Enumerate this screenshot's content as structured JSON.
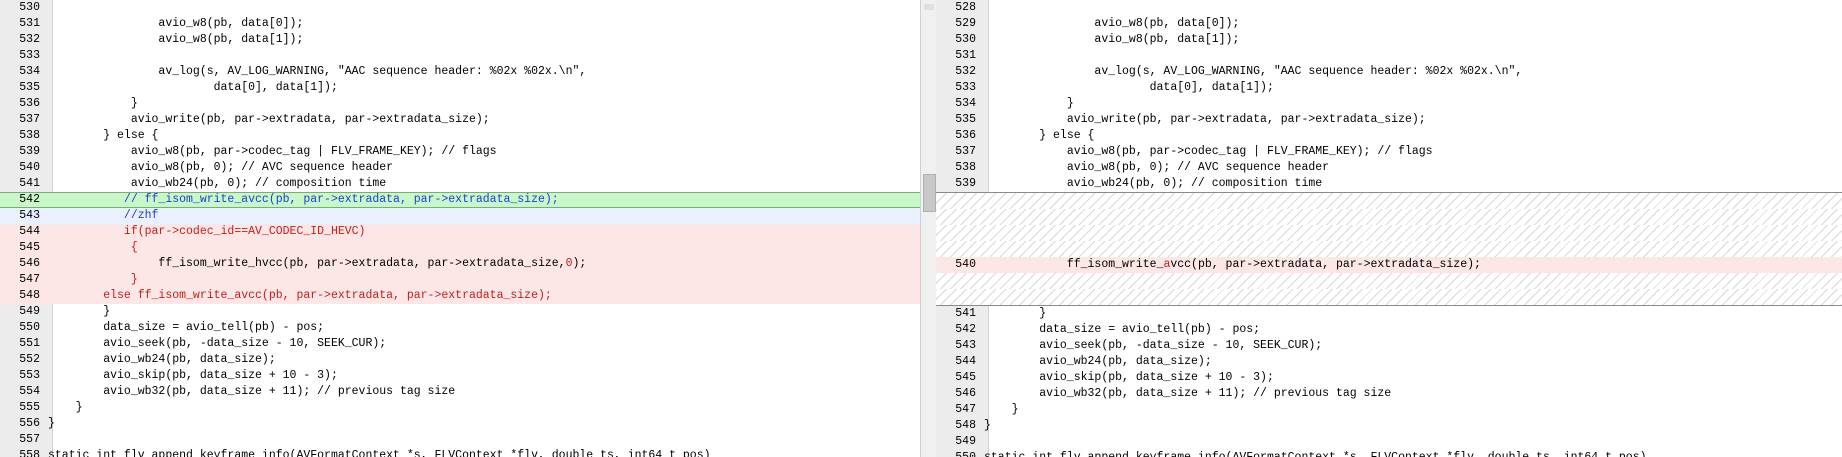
{
  "left": {
    "lines": [
      {
        "ln": "530",
        "code": "",
        "style": ""
      },
      {
        "ln": "531",
        "code": "                avio_w8(pb, data[0]);",
        "style": ""
      },
      {
        "ln": "532",
        "code": "                avio_w8(pb, data[1]);",
        "style": ""
      },
      {
        "ln": "533",
        "code": "",
        "style": ""
      },
      {
        "ln": "534",
        "code": "                av_log(s, AV_LOG_WARNING, \"AAC sequence header: %02x %02x.\\n\",",
        "style": ""
      },
      {
        "ln": "535",
        "code": "                        data[0], data[1]);",
        "style": ""
      },
      {
        "ln": "536",
        "code": "            }",
        "style": ""
      },
      {
        "ln": "537",
        "code": "            avio_write(pb, par->extradata, par->extradata_size);",
        "style": ""
      },
      {
        "ln": "538",
        "code": "        } else {",
        "style": ""
      },
      {
        "ln": "539",
        "code": "            avio_w8(pb, par->codec_tag | FLV_FRAME_KEY); // flags",
        "style": ""
      },
      {
        "ln": "540",
        "code": "            avio_w8(pb, 0); // AVC sequence header",
        "style": ""
      },
      {
        "ln": "541",
        "code": "            avio_wb24(pb, 0); // composition time",
        "style": ""
      },
      {
        "ln": "542",
        "code": "           // ff_isom_write_avcc(pb, par->extradata, par->extradata_size);",
        "style": "green-blue"
      },
      {
        "ln": "543",
        "code": "           //zhf",
        "style": "cur-blue"
      },
      {
        "ln": "544",
        "code": "           if(par->codec_id==AV_CODEC_ID_HEVC)",
        "style": "pink-red"
      },
      {
        "ln": "545",
        "code": "            {",
        "style": "pink-red"
      },
      {
        "ln": "546",
        "code": "                ff_isom_write_hvcc(pb, par->extradata, par->extradata_size,0);",
        "style": "pink-mixed"
      },
      {
        "ln": "547",
        "code": "            }",
        "style": "pink-red"
      },
      {
        "ln": "548",
        "code": "        else ff_isom_write_avcc(pb, par->extradata, par->extradata_size);",
        "style": "pink-red"
      },
      {
        "ln": "549",
        "code": "        }",
        "style": ""
      },
      {
        "ln": "550",
        "code": "        data_size = avio_tell(pb) - pos;",
        "style": ""
      },
      {
        "ln": "551",
        "code": "        avio_seek(pb, -data_size - 10, SEEK_CUR);",
        "style": ""
      },
      {
        "ln": "552",
        "code": "        avio_wb24(pb, data_size);",
        "style": ""
      },
      {
        "ln": "553",
        "code": "        avio_skip(pb, data_size + 10 - 3);",
        "style": ""
      },
      {
        "ln": "554",
        "code": "        avio_wb32(pb, data_size + 11); // previous tag size",
        "style": ""
      },
      {
        "ln": "555",
        "code": "    }",
        "style": ""
      },
      {
        "ln": "556",
        "code": "}",
        "style": ""
      },
      {
        "ln": "557",
        "code": "",
        "style": ""
      },
      {
        "ln": "558",
        "code": "static int flv_append_keyframe_info(AVFormatContext *s, FLVContext *flv, double ts, int64_t pos)",
        "style": ""
      }
    ]
  },
  "right": {
    "lines": [
      {
        "ln": "528",
        "code": "",
        "style": ""
      },
      {
        "ln": "529",
        "code": "                avio_w8(pb, data[0]);",
        "style": ""
      },
      {
        "ln": "530",
        "code": "                avio_w8(pb, data[1]);",
        "style": ""
      },
      {
        "ln": "531",
        "code": "",
        "style": ""
      },
      {
        "ln": "532",
        "code": "                av_log(s, AV_LOG_WARNING, \"AAC sequence header: %02x %02x.\\n\",",
        "style": ""
      },
      {
        "ln": "533",
        "code": "                        data[0], data[1]);",
        "style": ""
      },
      {
        "ln": "534",
        "code": "            }",
        "style": ""
      },
      {
        "ln": "535",
        "code": "            avio_write(pb, par->extradata, par->extradata_size);",
        "style": ""
      },
      {
        "ln": "536",
        "code": "        } else {",
        "style": ""
      },
      {
        "ln": "537",
        "code": "            avio_w8(pb, par->codec_tag | FLV_FRAME_KEY); // flags",
        "style": ""
      },
      {
        "ln": "538",
        "code": "            avio_w8(pb, 0); // AVC sequence header",
        "style": ""
      },
      {
        "ln": "539",
        "code": "            avio_wb24(pb, 0); // composition time",
        "style": ""
      },
      {
        "ln": "",
        "code": "",
        "style": "hatch-top"
      },
      {
        "ln": "",
        "code": "",
        "style": "hatch"
      },
      {
        "ln": "",
        "code": "",
        "style": "hatch"
      },
      {
        "ln": "",
        "code": "",
        "style": "hatch"
      },
      {
        "ln": "540",
        "code": "            ff_isom_write_avcc(pb, par->extradata, par->extradata_size);",
        "style": "pink-avcc"
      },
      {
        "ln": "",
        "code": "",
        "style": "hatch"
      },
      {
        "ln": "",
        "code": "",
        "style": "hatch-bottom"
      },
      {
        "ln": "541",
        "code": "        }",
        "style": ""
      },
      {
        "ln": "542",
        "code": "        data_size = avio_tell(pb) - pos;",
        "style": ""
      },
      {
        "ln": "543",
        "code": "        avio_seek(pb, -data_size - 10, SEEK_CUR);",
        "style": ""
      },
      {
        "ln": "544",
        "code": "        avio_wb24(pb, data_size);",
        "style": ""
      },
      {
        "ln": "545",
        "code": "        avio_skip(pb, data_size + 10 - 3);",
        "style": ""
      },
      {
        "ln": "546",
        "code": "        avio_wb32(pb, data_size + 11); // previous tag size",
        "style": ""
      },
      {
        "ln": "547",
        "code": "    }",
        "style": ""
      },
      {
        "ln": "548",
        "code": "}",
        "style": ""
      },
      {
        "ln": "549",
        "code": "",
        "style": ""
      },
      {
        "ln": "550",
        "code": "static int flv_append_keyframe_info(AVFormatContext *s, FLVContext *flv, double ts, int64_t pos)",
        "style": ""
      }
    ]
  },
  "colors": {
    "changed_line_bg": "#c9f7c9",
    "removed_line_bg": "#fde6e6",
    "added_text": "#1a3fd6",
    "removed_text": "#c0201b"
  }
}
